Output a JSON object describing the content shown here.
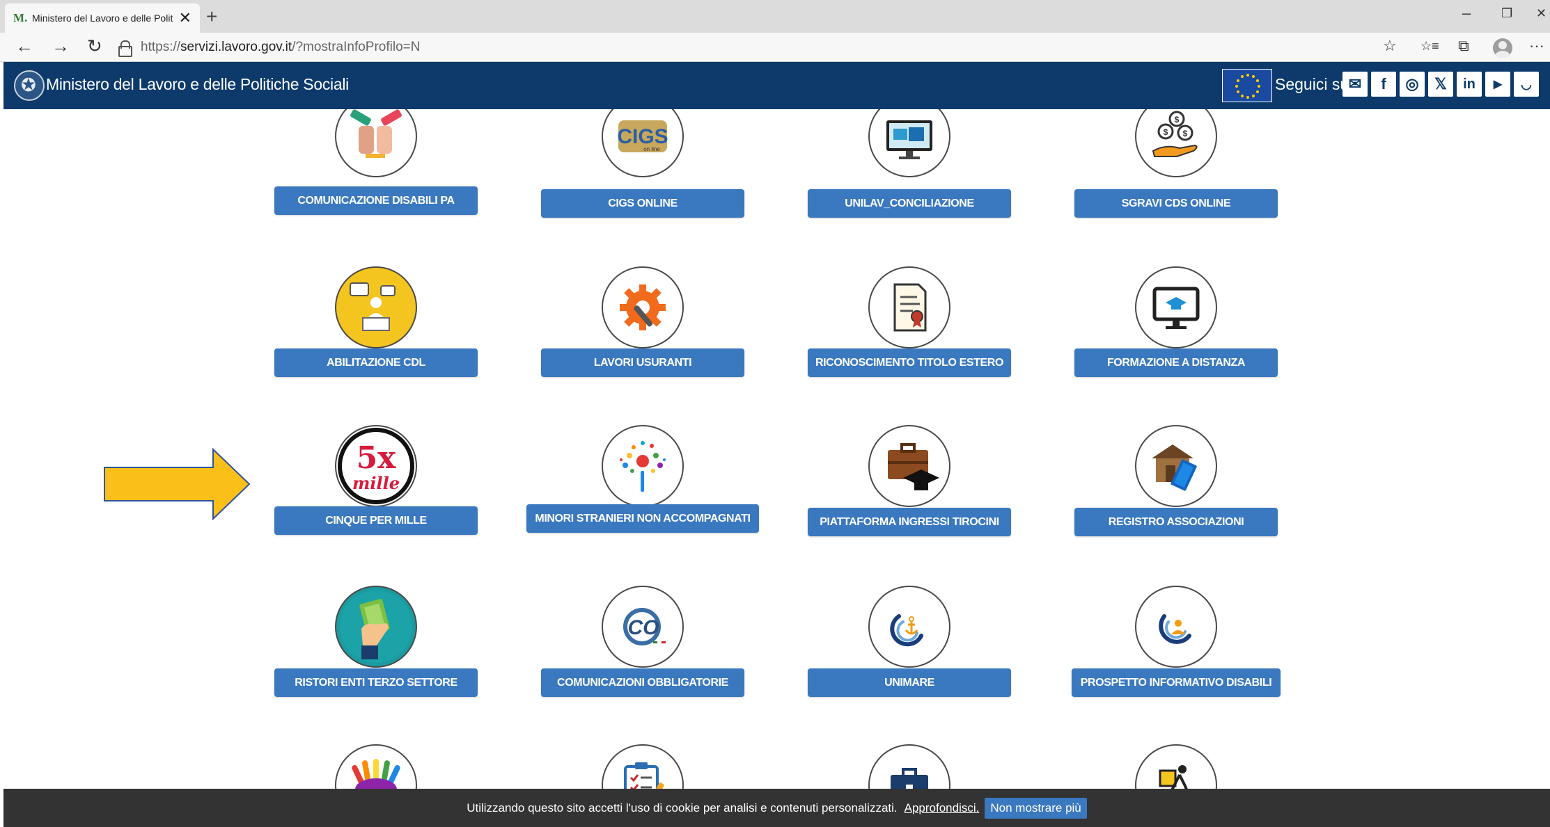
{
  "browser": {
    "tab_favicon": "M.",
    "tab_title": "Ministero del Lavoro e delle Polit",
    "tab_close": "✕",
    "new_tab": "+",
    "url_prefix": "https://",
    "url_host": "servizi.lavoro.gov.it",
    "url_path": "/?mostraInfoProfilo=N",
    "window_controls": {
      "minimize": "–",
      "restore": "❐",
      "close": "✕"
    },
    "nav": {
      "back": "←",
      "forward": "→",
      "refresh": "↻"
    },
    "toolbar_icons": {
      "favorite": "☆",
      "favorites_list": "☆≡",
      "collections": "⧉",
      "more": "···"
    }
  },
  "header": {
    "ministry_name": "Ministero del Lavoro e delle Politiche Sociali",
    "follow_label": "Seguici su:",
    "social": [
      {
        "name": "email-icon",
        "glyph": "✉"
      },
      {
        "name": "facebook-icon",
        "glyph": "f"
      },
      {
        "name": "instagram-icon",
        "glyph": "◎"
      },
      {
        "name": "x-icon",
        "glyph": "𝕏"
      },
      {
        "name": "linkedin-icon",
        "glyph": "in"
      },
      {
        "name": "youtube-icon",
        "glyph": "▶"
      },
      {
        "name": "rss-icon",
        "glyph": "◡"
      }
    ]
  },
  "services": {
    "row1": [
      {
        "label": "COMUNICAZIONE DISABILI PA",
        "icon": "handshake-icon"
      },
      {
        "label": "CIGS ONLINE",
        "icon": "cigs-logo-icon"
      },
      {
        "label": "UNILAV_CONCILIAZIONE",
        "icon": "monitor-puzzle-icon"
      },
      {
        "label": "SGRAVI CDS ONLINE",
        "icon": "coins-hand-icon"
      }
    ],
    "row2": [
      {
        "label": "ABILITAZIONE CDL",
        "icon": "speaker-podium-icon"
      },
      {
        "label": "LAVORI USURANTI",
        "icon": "gear-wrench-icon"
      },
      {
        "label": "RICONOSCIMENTO TITOLO ESTERO",
        "icon": "certificate-icon"
      },
      {
        "label": "FORMAZIONE A DISTANZA",
        "icon": "monitor-graduation-icon"
      }
    ],
    "row3": [
      {
        "label": "CINQUE PER MILLE",
        "icon": "cinque-per-mille-logo",
        "logo_main": "5x",
        "logo_sub": "mille"
      },
      {
        "label": "MINORI STRANIERI NON ACCOMPAGNATI",
        "icon": "dots-burst-icon"
      },
      {
        "label": "PIATTAFORMA INGRESSI TIROCINI",
        "icon": "briefcase-cap-icon"
      },
      {
        "label": "REGISTRO ASSOCIAZIONI",
        "icon": "house-book-icon"
      }
    ],
    "row4": [
      {
        "label": "RISTORI ENTI TERZO SETTORE",
        "icon": "money-hand-icon"
      },
      {
        "label": "COMUNICAZIONI OBBLIGATORIE",
        "icon": "co-at-logo-icon",
        "logo_main": "CO"
      },
      {
        "label": "UNIMARE",
        "icon": "anchor-logo-icon"
      },
      {
        "label": "PROSPETTO INFORMATIVO DISABILI",
        "icon": "person-swirl-icon"
      }
    ],
    "row5": [
      {
        "icon": "colorful-hands-icon"
      },
      {
        "icon": "checklist-icon"
      },
      {
        "icon": "briefcase-wave-icon"
      },
      {
        "icon": "delivery-bike-icon"
      }
    ]
  },
  "colors": {
    "header_bg": "#0d3a6b",
    "button_bg": "#3a78c0",
    "arrow_fill": "#fbbf1a",
    "arrow_stroke": "#2f5597",
    "cookie_bg": "#333333"
  },
  "cookie": {
    "text": "Utilizzando questo sito accetti l'uso di cookie per analisi e contenuti personalizzati.",
    "link": "Approfondisci.",
    "button": "Non mostrare più"
  }
}
